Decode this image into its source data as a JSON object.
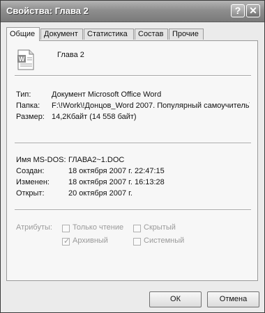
{
  "window": {
    "title": "Свойства: Глава 2",
    "help_glyph": "?",
    "close_glyph": "✕"
  },
  "tabs": [
    {
      "label": "Общие"
    },
    {
      "label": "Документ"
    },
    {
      "label": "Статистика"
    },
    {
      "label": "Состав"
    },
    {
      "label": "Прочие"
    }
  ],
  "general": {
    "file_icon": "word-document-icon",
    "file_name": "Глава 2",
    "type_label": "Тип:",
    "type_value": "Документ Microsoft Office Word",
    "folder_label": "Папка:",
    "folder_value": "F:\\!Work\\!Донцов_Word 2007. Популярный самоучитель\\",
    "size_label": "Размер:",
    "size_value": "14,2Кбайт (14 558 байт)",
    "msdos_label": "Имя MS-DOS:",
    "msdos_value": "ГЛАВА2~1.DOC",
    "created_label": "Создан:",
    "created_value": "18 октября 2007 г. 22:47:15",
    "modified_label": "Изменен:",
    "modified_value": "18 октября 2007 г. 16:13:28",
    "opened_label": "Открыт:",
    "opened_value": "20 октября 2007 г.",
    "attributes_label": "Атрибуты:",
    "attr_readonly": "Только чтение",
    "attr_hidden": "Скрытый",
    "attr_archive": "Архивный",
    "attr_system": "Системный",
    "attr_checked": {
      "readonly": false,
      "hidden": false,
      "archive": true,
      "system": false
    },
    "check_glyph": "✓"
  },
  "buttons": {
    "ok": "ОК",
    "cancel": "Отмена"
  }
}
